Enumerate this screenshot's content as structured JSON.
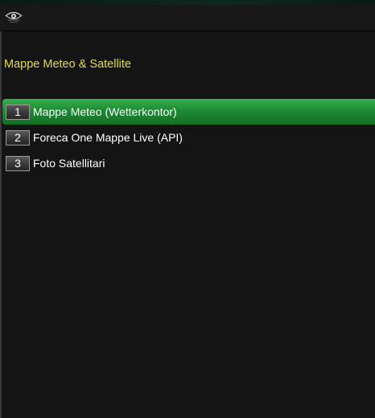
{
  "header": {
    "logo_icon": "eye-logo-icon"
  },
  "page": {
    "title": "Mappe Meteo & Satellite"
  },
  "menu": {
    "items": [
      {
        "number": "1",
        "label": "Mappe Meteo (Wetterkontor)",
        "selected": true
      },
      {
        "number": "2",
        "label": "Foreca One Mappe Live (API)",
        "selected": false
      },
      {
        "number": "3",
        "label": "Foto Satellitari",
        "selected": false
      }
    ]
  },
  "colors": {
    "title": "#e2dc3c",
    "selection": "#1e8a34",
    "background": "#141414"
  }
}
